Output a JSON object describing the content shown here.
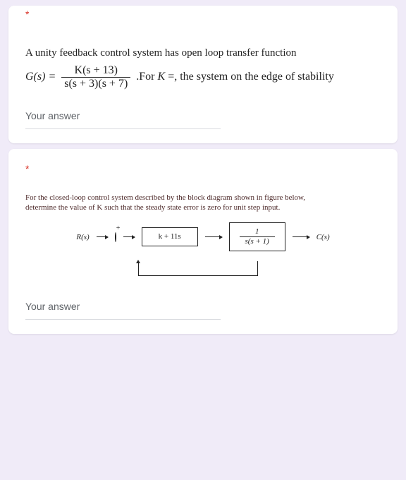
{
  "q1": {
    "required_mark": "*",
    "intro": "A unity feedback control system has open loop transfer function",
    "lhs": "G(s) =",
    "num": "K(s + 13)",
    "den": "s(s + 3)(s + 7)",
    "tail_prefix": ".For ",
    "tail_K": "K",
    "tail_rest": " =, the system on the edge of stability",
    "answer_label": "Your answer"
  },
  "q2": {
    "required_mark": "*",
    "line1": "For the closed-loop control system described by the block diagram shown in figure below,",
    "line2": "determine the value of   K   such that the steady state error is zero for unit step input.",
    "diagram": {
      "input": "R(s)",
      "sum_plus": "+",
      "block1": "k + 11s",
      "block2_num": "1",
      "block2_den": "s(s + 1)",
      "output": "C(s)"
    },
    "answer_label": "Your answer"
  }
}
